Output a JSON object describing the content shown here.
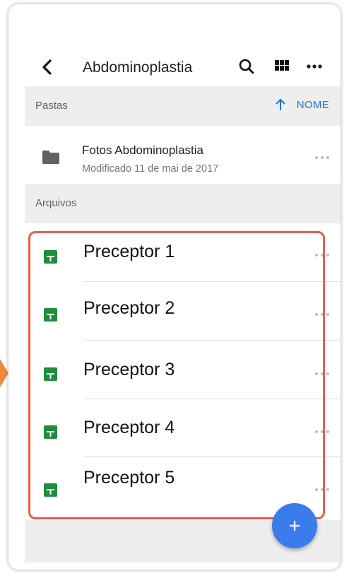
{
  "header": {
    "title": "Abdominoplastia"
  },
  "folders_section": {
    "label": "Pastas",
    "sort_label": "NOME"
  },
  "folder": {
    "name": "Fotos Abdominoplastia",
    "modified": "Modificado 11 de mai de 2017"
  },
  "files_section": {
    "label": "Arquivos"
  },
  "files": [
    {
      "name": "Preceptor 1"
    },
    {
      "name": "Preceptor 2"
    },
    {
      "name": "Preceptor 3"
    },
    {
      "name": "Preceptor 4"
    },
    {
      "name": "Preceptor 5"
    }
  ],
  "icons": {
    "back": "chevron-left-icon",
    "search": "search-icon",
    "grid": "grid-view-icon",
    "more": "more-horizontal-icon",
    "sort": "arrow-up-icon",
    "folder": "folder-icon",
    "file": "google-sheets-icon",
    "fab": "plus-icon"
  },
  "colors": {
    "accent": "#1a73e8",
    "fab": "#3b7ced",
    "sheet_green": "#1e8e3e",
    "highlight": "#ef5b4f",
    "section_bg": "#eeeeef"
  }
}
